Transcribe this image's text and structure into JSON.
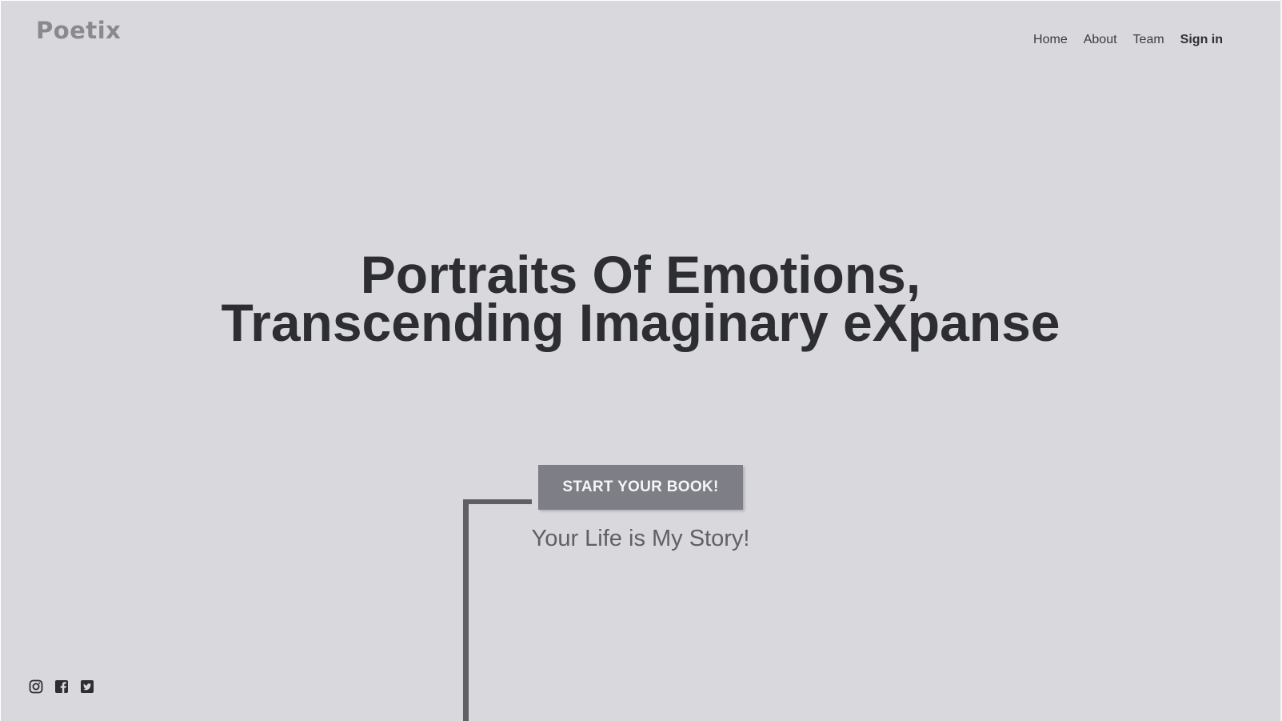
{
  "brand": {
    "logo": "Poetix"
  },
  "nav": {
    "items": [
      {
        "label": "Home"
      },
      {
        "label": "About"
      },
      {
        "label": "Team"
      },
      {
        "label": "Sign in"
      }
    ]
  },
  "hero": {
    "title_line1": "Portraits Of Emotions,",
    "title_line2": "Transcending Imaginary eXpanse",
    "cta_label": "START YOUR BOOK!",
    "tagline": "Your Life is My Story!"
  },
  "social": {
    "icons": [
      "instagram-icon",
      "facebook-icon",
      "twitter-icon"
    ]
  },
  "colors": {
    "background": "#d9d9dd",
    "logo": "#888a8f",
    "text_dark": "#2d2e32",
    "button": "#7d7e86",
    "connector": "#5f6066"
  }
}
